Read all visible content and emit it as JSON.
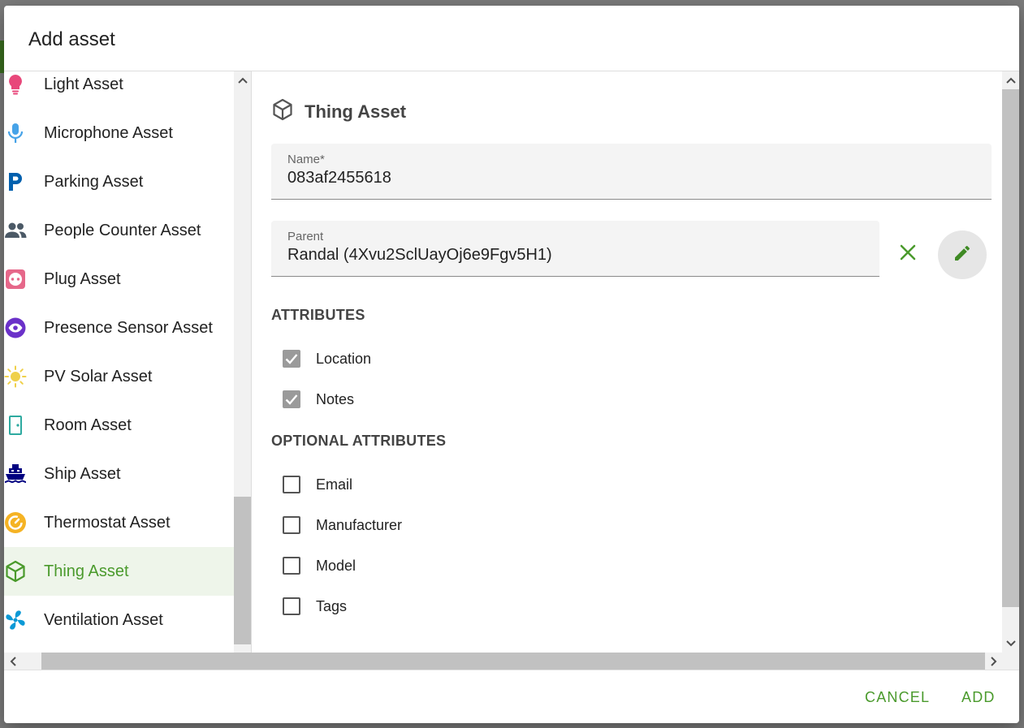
{
  "dialog": {
    "title": "Add asset"
  },
  "asset_list": [
    {
      "label": "Light Asset",
      "icon": "lightbulb-icon",
      "color": "#e8477a"
    },
    {
      "label": "Microphone Asset",
      "icon": "microphone-icon",
      "color": "#47a3e8"
    },
    {
      "label": "Parking Asset",
      "icon": "parking-icon",
      "color": "#0260ae"
    },
    {
      "label": "People Counter Asset",
      "icon": "people-icon",
      "color": "#4b5966"
    },
    {
      "label": "Plug Asset",
      "icon": "power-socket-icon",
      "color": "#e6688a"
    },
    {
      "label": "Presence Sensor Asset",
      "icon": "eye-icon",
      "color": "#6b31c9"
    },
    {
      "label": "PV Solar Asset",
      "icon": "sun-icon",
      "color": "#efd04a"
    },
    {
      "label": "Room Asset",
      "icon": "door-icon",
      "color": "#2eaaa0"
    },
    {
      "label": "Ship Asset",
      "icon": "ship-icon",
      "color": "#000080"
    },
    {
      "label": "Thermostat Asset",
      "icon": "thermostat-icon",
      "color": "#f5b324"
    },
    {
      "label": "Thing Asset",
      "icon": "cube-icon",
      "color": "#4a9a2c",
      "selected": true
    },
    {
      "label": "Ventilation Asset",
      "icon": "fan-icon",
      "color": "#0b99d6"
    }
  ],
  "detail": {
    "asset_type": "Thing Asset",
    "name_label": "Name*",
    "name_value": "083af2455618",
    "parent_label": "Parent",
    "parent_value": "Randal (4Xvu2SclUayOj6e9Fgv5H1)",
    "attributes_title": "ATTRIBUTES",
    "attributes": [
      {
        "label": "Location",
        "checked": true
      },
      {
        "label": "Notes",
        "checked": true
      }
    ],
    "optional_title": "OPTIONAL ATTRIBUTES",
    "optional_attributes": [
      {
        "label": "Email",
        "checked": false
      },
      {
        "label": "Manufacturer",
        "checked": false
      },
      {
        "label": "Model",
        "checked": false
      },
      {
        "label": "Tags",
        "checked": false
      }
    ]
  },
  "footer": {
    "cancel_label": "CANCEL",
    "add_label": "ADD"
  },
  "colors": {
    "accent": "#4a9a2c",
    "selected_bg": "#eef5ea"
  }
}
